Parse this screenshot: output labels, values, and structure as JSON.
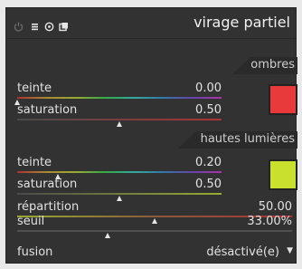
{
  "module": {
    "title": "virage partiel",
    "icons": [
      "power-icon",
      "presets-icon",
      "reset-icon",
      "multi-instance-icon"
    ]
  },
  "shadows": {
    "section_label": "ombres",
    "hue": {
      "label": "teinte",
      "value": "0.00",
      "level": 0.0
    },
    "saturation": {
      "label": "saturation",
      "value": "0.50",
      "level": 0.5
    },
    "color": "#e8393b"
  },
  "highlights": {
    "section_label": "hautes lumières",
    "hue": {
      "label": "teinte",
      "value": "0.20",
      "level": 0.2
    },
    "saturation": {
      "label": "saturation",
      "value": "0.50",
      "level": 0.5
    },
    "color": "#c9e02c"
  },
  "balance": {
    "label": "répartition",
    "value": "50.00",
    "level": 0.5
  },
  "compress": {
    "label": "seuil",
    "value": "33.00%",
    "level": 0.33
  },
  "fusion": {
    "label": "fusion",
    "value": "désactivé(e)"
  }
}
